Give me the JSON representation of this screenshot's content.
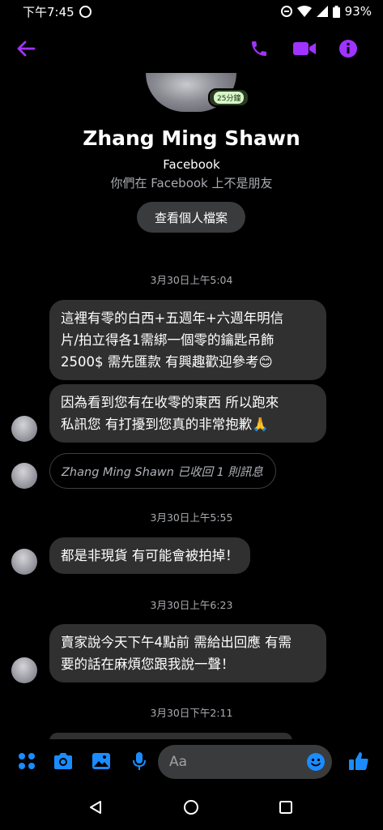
{
  "status_bar": {
    "time": "下午7:45",
    "battery": "93%"
  },
  "header": {
    "back_icon": "back-arrow-icon",
    "call_icon": "phone-icon",
    "video_icon": "video-camera-icon",
    "info_icon": "info-icon",
    "accent": "#a033ff"
  },
  "profile": {
    "active_badge": "25分鐘",
    "name": "Zhang Ming Shawn",
    "platform": "Facebook",
    "friend_status": "你們在 Facebook 上不是朋友",
    "view_profile_label": "查看個人檔案"
  },
  "messages": {
    "ts1": "3月30日上午5:04",
    "m1_line1": "這裡有零的白西+五週年+六週年明信",
    "m1_line2": "片/拍立得各1需綁一個零的鑰匙吊飾",
    "m1_line3": "2500$ 需先匯款 有興趣歡迎參考😊",
    "m2_line1": "因為看到您有在收零的東西 所以跑來",
    "m2_line2": "私訊您 有打擾到您真的非常抱歉🙏",
    "retracted": "Zhang Ming Shawn 已收回 1 則訊息",
    "ts2": "3月30日上午5:55",
    "m3": "都是非現貨 有可能會被拍掉！",
    "ts3": "3月30日上午6:23",
    "m4_line1": "賣家說今天下午4點前 需給出回應 有需",
    "m4_line2": "要的話在麻煩您跟我說一聲！",
    "ts4": "3月30日下午2:11"
  },
  "composer": {
    "placeholder": "Aa",
    "icons": [
      "apps-icon",
      "camera-icon",
      "gallery-icon",
      "microphone-icon",
      "emoji-icon",
      "thumbs-up-icon"
    ],
    "accent": "#1a8cff"
  },
  "nav": {
    "icons": [
      "back-triangle-icon",
      "home-circle-icon",
      "recents-square-icon"
    ]
  }
}
